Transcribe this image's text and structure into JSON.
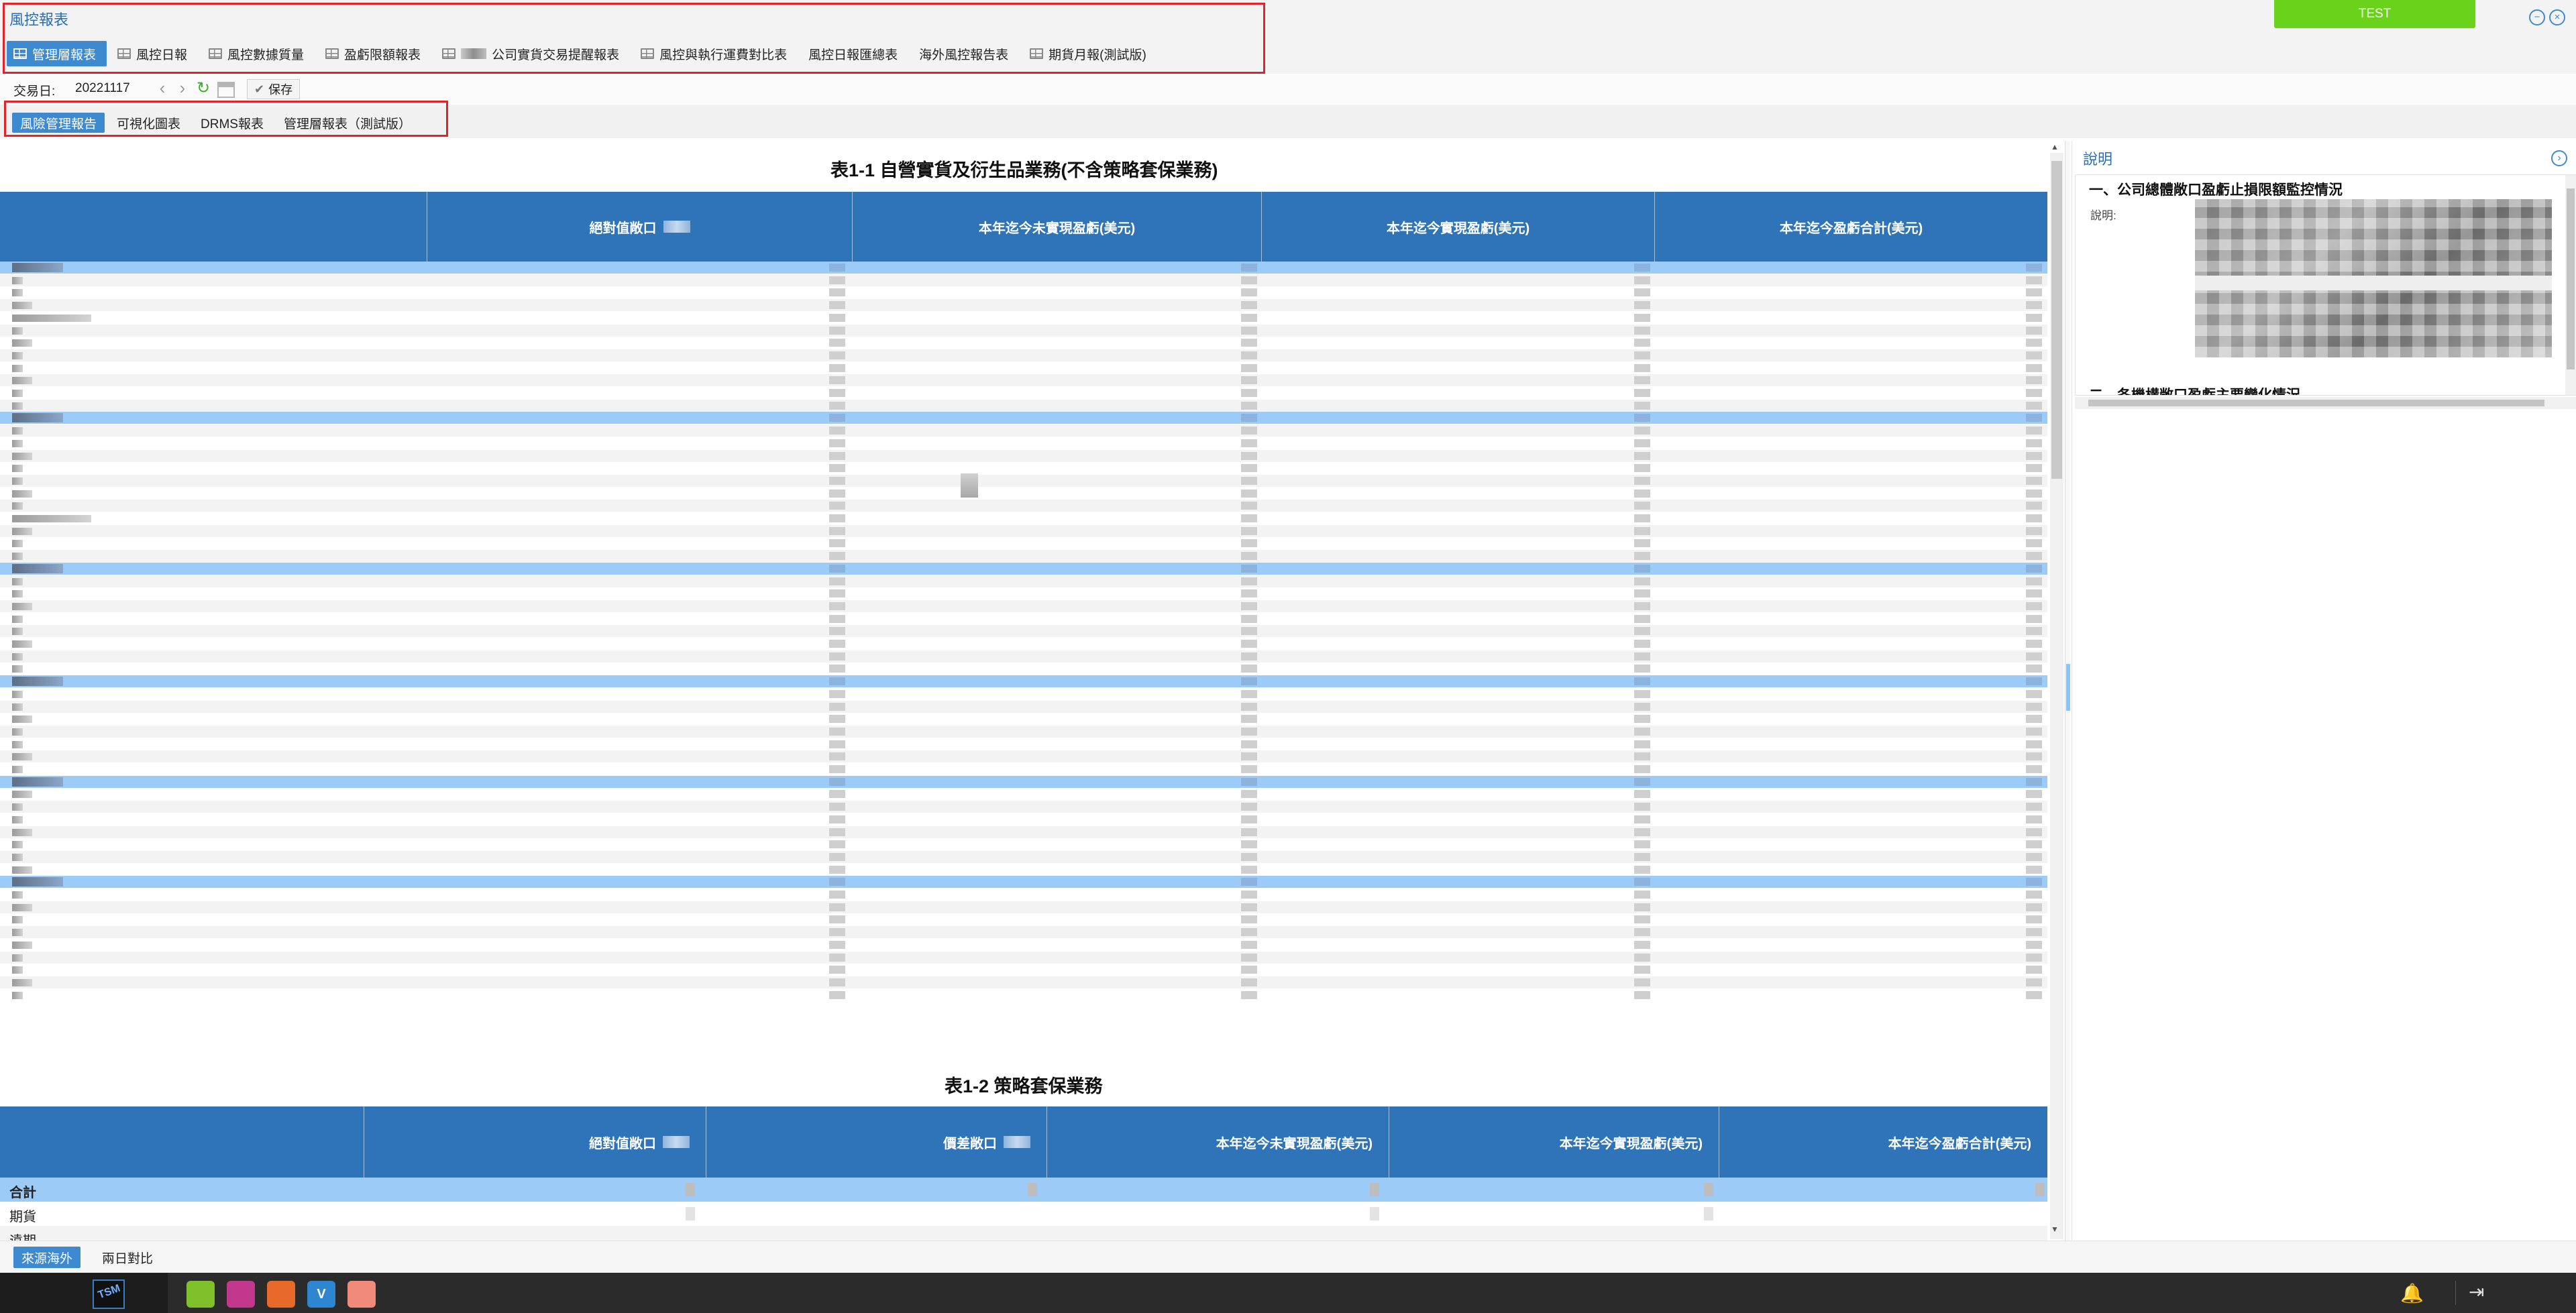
{
  "app": {
    "title": "風控報表",
    "test_button": "TEST",
    "minimize_glyph": "−",
    "close_glyph": "×"
  },
  "report_tabs": [
    {
      "label": "管理層報表",
      "active": true
    },
    {
      "label": "風控日報"
    },
    {
      "label": "風控數據質量"
    },
    {
      "label": "盈虧限額報表"
    },
    {
      "label": "公司實貨交易提醒報表"
    },
    {
      "label": "風控與執行運費對比表"
    },
    {
      "label": "風控日報匯總表"
    },
    {
      "label": "海外風控報告表"
    },
    {
      "label": "期貨月報(測試版)"
    }
  ],
  "toolbar": {
    "date_label": "交易日:",
    "date_value": "20221117",
    "prev_glyph": "‹",
    "next_glyph": "›",
    "refresh_glyph": "↻",
    "save_check_glyph": "✔",
    "save_label": "保存"
  },
  "sub_tabs": [
    {
      "label": "風險管理報告",
      "active": true
    },
    {
      "label": "可視化圖表"
    },
    {
      "label": "DRMS報表"
    },
    {
      "label": "管理層報表（測試版）"
    }
  ],
  "table1": {
    "title": "表1-1 自營實貨及衍生品業務(不含策略套保業務)",
    "columns": [
      "",
      "絕對值敞口",
      "本年迄今未實現盈虧(美元)",
      "本年迄今實現盈虧(美元)",
      "本年迄今盈虧合計(美元)"
    ]
  },
  "table2": {
    "title": "表1-2 策略套保業務",
    "columns": [
      "",
      "絕對值敞口",
      "價差敞口",
      "本年迄今未實現盈虧(美元)",
      "本年迄今實現盈虧(美元)",
      "本年迄今盈虧合計(美元)"
    ],
    "rows": [
      {
        "label": "合計"
      },
      {
        "label": "期貨"
      },
      {
        "label": "遠期"
      }
    ]
  },
  "description": {
    "title": "說明",
    "collapse_glyph": "›",
    "section1_title": "一、公司總體敞口盈虧止損限額監控情況",
    "section1_label": "說明:",
    "section2_title": "二、各機構敞口盈虧主要變化情況"
  },
  "bottom_tabs": [
    {
      "label": "來源海外",
      "active": true
    },
    {
      "label": "兩日對比"
    }
  ],
  "taskbar": {
    "bell_glyph": "🔔",
    "exit_glyph": "⇥",
    "app_badges": [
      "",
      "",
      "",
      "V",
      ""
    ],
    "app_colors": [
      "#7fbf2a",
      "#c2388c",
      "#e86a2a",
      "#2f86d0",
      "#f08a7a"
    ]
  },
  "accent": {
    "primary": "#3d8ad0",
    "header": "#2f74b8",
    "highlight_row": "#9ccbf7",
    "test_green": "#6ad21a",
    "frame_red": "#e0242a"
  }
}
